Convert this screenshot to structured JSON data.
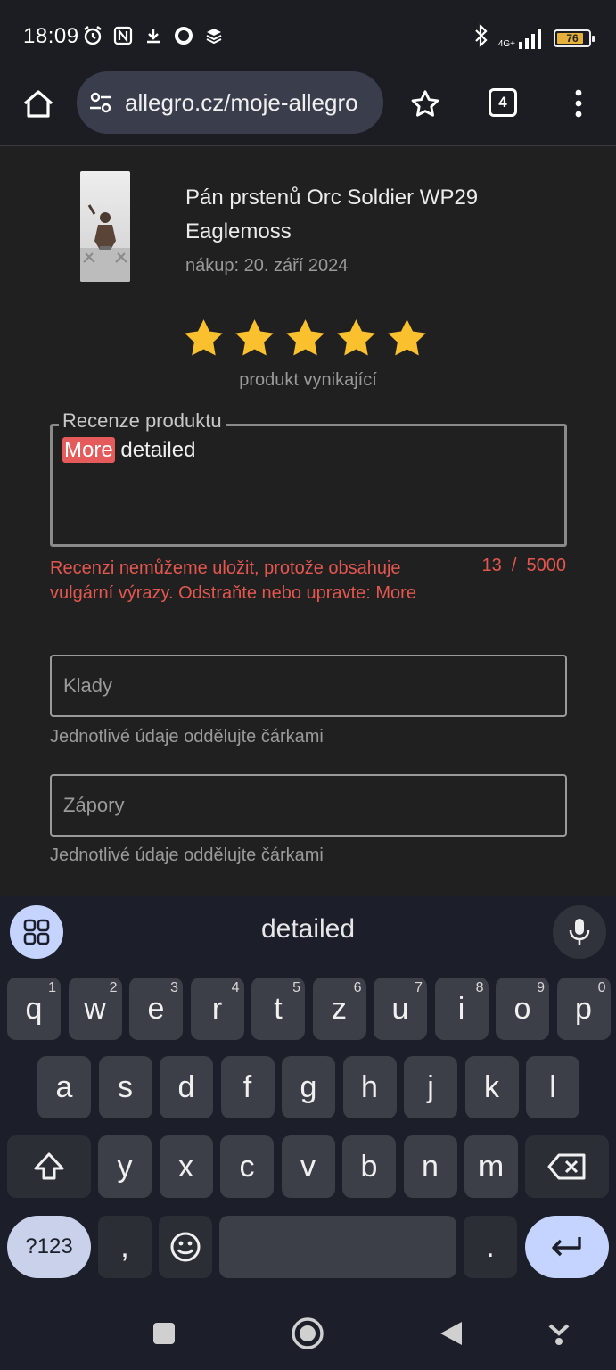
{
  "status_bar": {
    "time": "18:09",
    "network": "4G+",
    "battery": "76"
  },
  "browser": {
    "url": "allegro.cz/moje-allegro",
    "tab_count": "4"
  },
  "product": {
    "title": "Pán prstenů Orc Soldier WP29 Eaglemoss",
    "date": "nákup: 20. září 2024",
    "rating_stars": 5,
    "rating_label": "produkt vynikající"
  },
  "review": {
    "legend": "Recenze produktu",
    "highlighted_word": "More",
    "rest_text": " detailed",
    "error": "Recenzi nemůžeme uložit, protože obsahuje vulgární výrazy. Odstraňte nebo upravte: More",
    "counter": "13  /  5000"
  },
  "pros": {
    "placeholder": "Klady",
    "hint": "Jednotlivé údaje oddělujte čárkami"
  },
  "cons": {
    "placeholder": "Zápory",
    "hint": "Jednotlivé údaje oddělujte čárkami"
  },
  "keyboard": {
    "suggestion": "detailed",
    "row1": [
      {
        "k": "q",
        "n": "1"
      },
      {
        "k": "w",
        "n": "2"
      },
      {
        "k": "e",
        "n": "3"
      },
      {
        "k": "r",
        "n": "4"
      },
      {
        "k": "t",
        "n": "5"
      },
      {
        "k": "z",
        "n": "6"
      },
      {
        "k": "u",
        "n": "7"
      },
      {
        "k": "i",
        "n": "8"
      },
      {
        "k": "o",
        "n": "9"
      },
      {
        "k": "p",
        "n": "0"
      }
    ],
    "row2": [
      "a",
      "s",
      "d",
      "f",
      "g",
      "h",
      "j",
      "k",
      "l"
    ],
    "row3": [
      "y",
      "x",
      "c",
      "v",
      "b",
      "n",
      "m"
    ],
    "symbols_label": "?123",
    "comma": ",",
    "period": "."
  }
}
